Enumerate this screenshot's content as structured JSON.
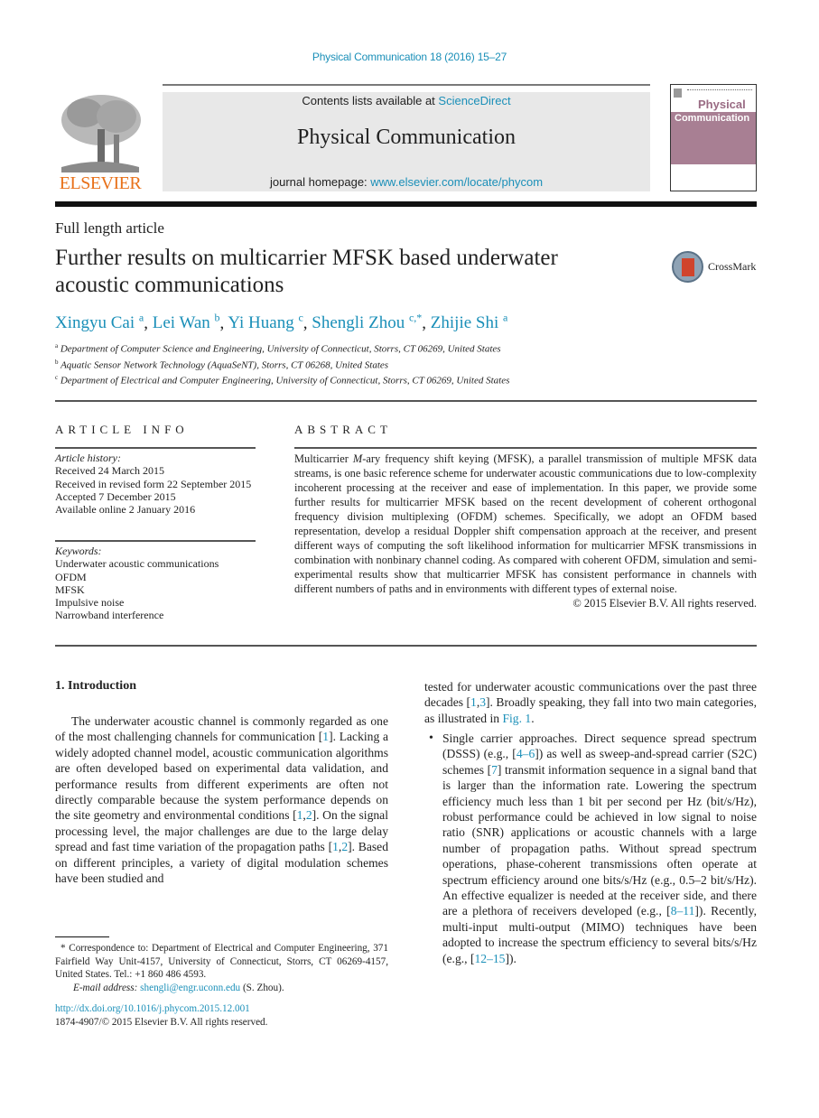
{
  "journal_ref": "Physical Communication 18 (2016) 15–27",
  "header": {
    "publisher_logo_text": "ELSEVIER",
    "contents_prefix": "Contents lists available at ",
    "contents_link": "ScienceDirect",
    "journal_title": "Physical Communication",
    "homepage_prefix": "journal homepage: ",
    "homepage_link": "www.elsevier.com/locate/phycom",
    "cover_title_line1": "Physical",
    "cover_title_line2": "Communication"
  },
  "article": {
    "type": "Full length article",
    "title": "Further results on multicarrier MFSK based underwater acoustic communications",
    "crossmark_label": "CrossMark",
    "authors": [
      {
        "name": "Xingyu Cai",
        "sup": "a"
      },
      {
        "name": "Lei Wan",
        "sup": "b"
      },
      {
        "name": "Yi Huang",
        "sup": "c"
      },
      {
        "name": "Shengli Zhou",
        "sup": "c,*"
      },
      {
        "name": "Zhijie Shi",
        "sup": "a"
      }
    ],
    "affiliations": [
      {
        "sup": "a",
        "text": "Department of Computer Science and Engineering, University of Connecticut, Storrs, CT 06269, United States"
      },
      {
        "sup": "b",
        "text": "Aquatic Sensor Network Technology (AquaSeNT), Storrs, CT 06268, United States"
      },
      {
        "sup": "c",
        "text": "Department of Electrical and Computer Engineering, University of Connecticut, Storrs, CT 06269, United States"
      }
    ]
  },
  "article_info": {
    "heading": "ARTICLE INFO",
    "history_label": "Article history:",
    "history": [
      "Received 24 March 2015",
      "Received in revised form 22 September 2015",
      "Accepted 7 December 2015",
      "Available online 2 January 2016"
    ],
    "keywords_label": "Keywords:",
    "keywords": [
      "Underwater acoustic communications",
      "OFDM",
      "MFSK",
      "Impulsive noise",
      "Narrowband interference"
    ]
  },
  "abstract": {
    "heading": "ABSTRACT",
    "text_pre": "Multicarrier ",
    "text_italic": "M",
    "text_post": "-ary frequency shift keying (MFSK), a parallel transmission of multiple MFSK data streams, is one basic reference scheme for underwater acoustic communications due to low-complexity incoherent processing at the receiver and ease of implementation. In this paper, we provide some further results for multicarrier MFSK based on the recent development of coherent orthogonal frequency division multiplexing (OFDM) schemes. Specifically, we adopt an OFDM based representation, develop a residual Doppler shift compensation approach at the receiver, and present different ways of computing the soft likelihood information for multicarrier MFSK transmissions in combination with nonbinary channel coding. As compared with coherent OFDM, simulation and semi-experimental results show that multicarrier MFSK has consistent performance in channels with different numbers of paths and in environments with different types of external noise.",
    "copyright": "© 2015 Elsevier B.V. All rights reserved."
  },
  "intro": {
    "heading": "1.  Introduction",
    "p1": [
      {
        "t": "The underwater acoustic channel is commonly regarded as one of the most challenging channels for communication ["
      },
      {
        "l": "1"
      },
      {
        "t": "]. Lacking a widely adopted channel model, acoustic communication algorithms are often developed based on experimental data validation, and performance results from different experiments are often not directly comparable because the system performance depends on the site geometry and environmental conditions ["
      },
      {
        "l": "1"
      },
      {
        "t": ","
      },
      {
        "l": "2"
      },
      {
        "t": "]. On the signal processing level, the major challenges are due to the large delay spread and fast time variation of the propagation paths ["
      },
      {
        "l": "1"
      },
      {
        "t": ","
      },
      {
        "l": "2"
      },
      {
        "t": "]. Based on different principles, a variety of digital modulation schemes have been studied and"
      }
    ],
    "p2": [
      {
        "t": "tested for underwater acoustic communications over the past three decades ["
      },
      {
        "l": "1"
      },
      {
        "t": ","
      },
      {
        "l": "3"
      },
      {
        "t": "]. Broadly speaking, they fall into two main categories, as illustrated in "
      },
      {
        "l": "Fig. 1"
      },
      {
        "t": "."
      }
    ],
    "bullet": [
      {
        "t": "Single carrier approaches. Direct sequence spread spectrum (DSSS) (e.g., ["
      },
      {
        "l": "4–6"
      },
      {
        "t": "]) as well as sweep-and-spread carrier (S2C) schemes ["
      },
      {
        "l": "7"
      },
      {
        "t": "] transmit information sequence in a signal band that is larger than the information rate. Lowering the spectrum efficiency much less than 1 bit per second per Hz (bit/s/Hz), robust performance could be achieved in low signal to noise ratio (SNR) applications or acoustic channels with a large number of propagation paths. Without spread spectrum operations, phase-coherent transmissions often operate at spectrum efficiency around one bits/s/Hz (e.g., 0.5–2 bit/s/Hz). An effective equalizer is needed at the receiver side, and there are a plethora of receivers developed (e.g., ["
      },
      {
        "l": "8–11"
      },
      {
        "t": "]). Recently, multi-input multi-output (MIMO) techniques have been adopted to increase the spectrum efficiency to several bits/s/Hz (e.g., ["
      },
      {
        "l": "12–15"
      },
      {
        "t": "])."
      }
    ]
  },
  "footnote": {
    "marker": "*",
    "text": "Correspondence to: Department of Electrical and Computer Engineering, 371 Fairfield Way Unit-4157, University of Connecticut, Storrs, CT 06269-4157, United States. Tel.: +1 860 486 4593.",
    "email_label": "E-mail address: ",
    "email": "shengli@engr.uconn.edu",
    "email_suffix": " (S. Zhou).",
    "doi": "http://dx.doi.org/10.1016/j.phycom.2015.12.001",
    "issn_copyright": "1874-4907/© 2015 Elsevier B.V. All rights reserved."
  },
  "colors": {
    "link": "#1a8fb8",
    "elsevier_orange": "#e8711a",
    "header_box": "#e8e8e8",
    "cover_pink": "#a87f93"
  }
}
